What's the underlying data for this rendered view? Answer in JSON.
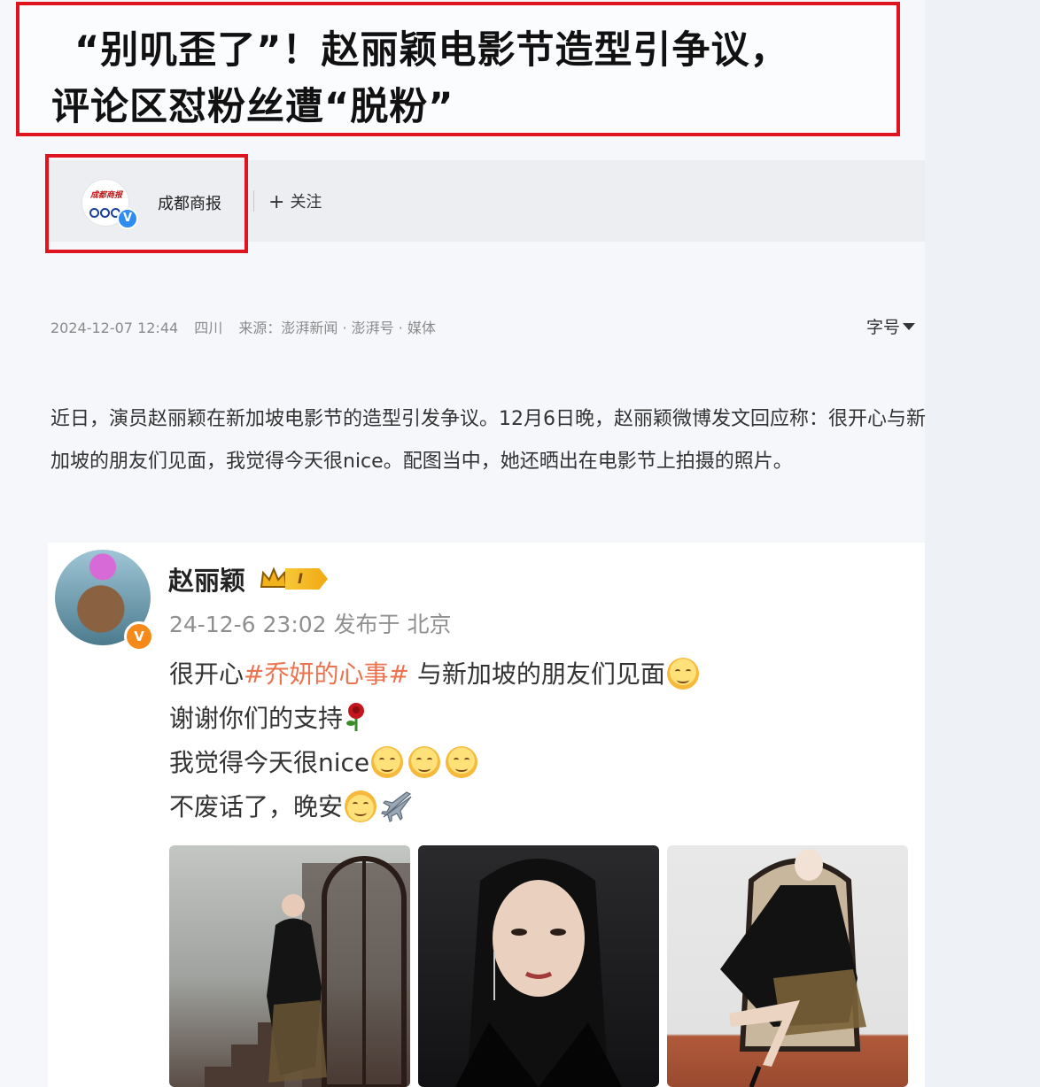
{
  "headline": {
    "line1": "“别叽歪了”！赵丽颖电影节造型引争议，",
    "line2": "评论区怼粉丝遭“脱粉”"
  },
  "account": {
    "logo_text": "成都商报",
    "name": "成都商报",
    "follow_label": "关注"
  },
  "meta": {
    "datetime": "2024-12-07 12:44",
    "region": "四川",
    "source": "来源：澎湃新闻 · 澎湃号 · 媒体",
    "font_size_label": "字号"
  },
  "article": {
    "paragraph": "近日，演员赵丽颖在新加坡电影节的造型引发争议。12月6日晚，赵丽颖微博发文回应称：很开心与新加坡的朋友们见面，我觉得今天很nice。配图当中，她还晒出在电影节上拍摄的照片。"
  },
  "weibo_post": {
    "username": "赵丽颖",
    "level_badge": "I",
    "time_location": "24-12-6 23:02 发布于 北京",
    "line1_prefix": "很开心",
    "hashtag": "#乔妍的心事#",
    "line1_suffix": " 与新加坡的朋友们见面",
    "line2": "谢谢你们的支持",
    "line3": "我觉得今天很nice",
    "line4": "不废话了，晚安",
    "emoji_names": [
      "face-blowing-kiss",
      "rose",
      "smile",
      "smile",
      "smile",
      "partying-face",
      "airplane"
    ]
  },
  "colors": {
    "highlight_border": "#e0141e",
    "hashtag": "#eb7350",
    "verified_blue": "#2f8df0",
    "verified_orange": "#f58a1a"
  }
}
